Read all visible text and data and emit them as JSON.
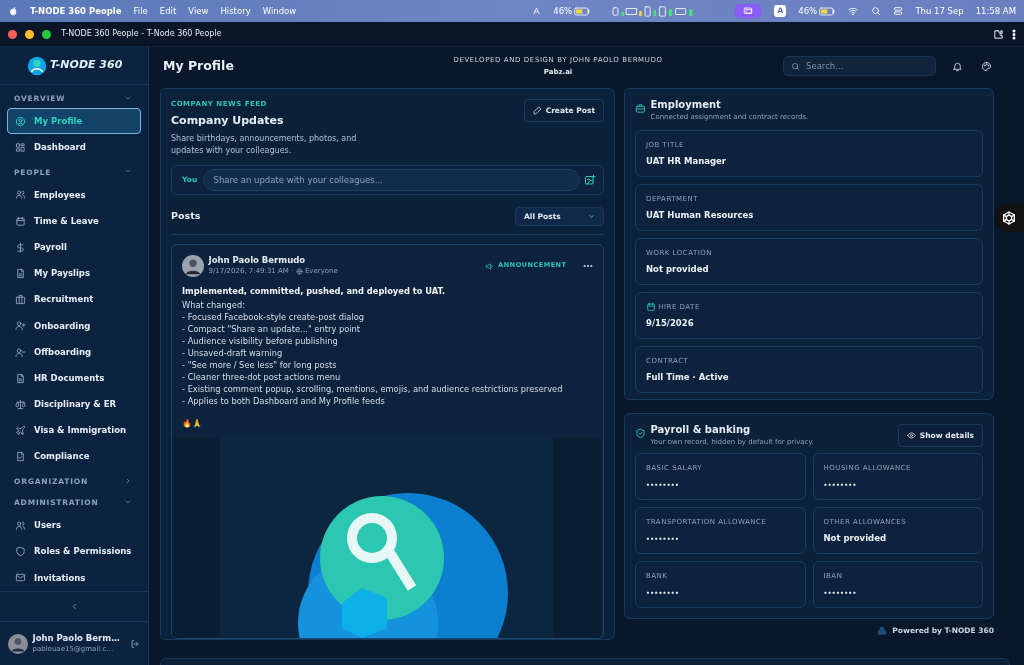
{
  "menubar": {
    "app": "T-NODE 360 People",
    "menus": [
      "File",
      "Edit",
      "View",
      "History",
      "Window"
    ],
    "battery_readings": [
      "46%",
      "46%"
    ],
    "input_source": "A",
    "date": "Thu 17 Sep",
    "time": "11:58 AM"
  },
  "browser": {
    "title": "T-NODE 360 People - T-Node 360 People"
  },
  "brand": {
    "name": "T-NODE 360"
  },
  "header": {
    "title": "My Profile",
    "credit": "DEVELOPED AND DESIGN BY JOHN PAOLO BERMUDO",
    "credit_sub": "Pabz.ai",
    "search": {
      "placeholder": "Search..."
    }
  },
  "sidebar": {
    "sections": [
      {
        "label": "OVERVIEW",
        "expanded": true,
        "items": [
          {
            "label": "My Profile",
            "selected": true
          },
          {
            "label": "Dashboard",
            "selected": false
          }
        ]
      },
      {
        "label": "PEOPLE",
        "expanded": true,
        "items": [
          {
            "label": "Employees",
            "selected": false
          },
          {
            "label": "Time & Leave",
            "selected": false
          },
          {
            "label": "Payroll",
            "selected": false
          },
          {
            "label": "My Payslips",
            "selected": false
          },
          {
            "label": "Recruitment",
            "selected": false
          },
          {
            "label": "Onboarding",
            "selected": false
          },
          {
            "label": "Offboarding",
            "selected": false
          },
          {
            "label": "HR Documents",
            "selected": false
          },
          {
            "label": "Disciplinary & ER",
            "selected": false
          },
          {
            "label": "Visa & Immigration",
            "selected": false
          },
          {
            "label": "Compliance",
            "selected": false
          }
        ]
      },
      {
        "label": "ORGANIZATION",
        "expanded": false
      },
      {
        "label": "ADMINISTRATION",
        "expanded": true,
        "items": [
          {
            "label": "Users",
            "selected": false
          },
          {
            "label": "Roles & Permissions",
            "selected": false
          },
          {
            "label": "Invitations",
            "selected": false
          }
        ]
      }
    ],
    "user": {
      "name": "John Paolo Berm…",
      "email": "pablouae15@gmail.c…"
    }
  },
  "feed": {
    "eyebrow": "COMPANY NEWS FEED",
    "title": "Company Updates",
    "description": "Share birthdays, announcements, photos, and updates with your colleagues.",
    "create_button": "Create Post",
    "composer": {
      "label": "You",
      "placeholder": "Share an update with your colleagues..."
    },
    "posts_title": "Posts",
    "filter": {
      "value": "All Posts"
    },
    "posts": [
      {
        "author": "John Paolo Bermudo",
        "timestamp": "9/17/2026, 7:49:31 AM",
        "separator": "·",
        "audience": "Everyone",
        "tag": "ANNOUNCEMENT",
        "headline": "Implemented, committed, pushed, and deployed to UAT.",
        "lines": [
          "What changed:",
          "- Focused Facebook-style create-post dialog",
          "- Compact \"Share an update...\" entry point",
          "- Audience visibility before publishing",
          "- Unsaved-draft warning",
          "- \"See more / See less\" for long posts",
          "- Cleaner three-dot post actions menu",
          "- Existing comment popup, scrolling, mentions, emojis, and audience restrictions preserved",
          "- Applies to both Dashboard and My Profile feeds"
        ],
        "emoji": "🔥🙏"
      }
    ]
  },
  "employment": {
    "title": "Employment",
    "subtitle": "Connected assignment and contract records.",
    "fields": [
      {
        "label": "JOB TITLE",
        "value": "UAT HR Manager",
        "kind": "text"
      },
      {
        "label": "DEPARTMENT",
        "value": "UAT Human Resources",
        "kind": "text"
      },
      {
        "label": "WORK LOCATION",
        "value": "Not provided",
        "kind": "text"
      },
      {
        "label": "HIRE DATE",
        "value": "9/15/2026",
        "kind": "date"
      },
      {
        "label": "CONTRACT",
        "value": "Full Time · Active",
        "kind": "text"
      }
    ]
  },
  "payroll": {
    "title": "Payroll & banking",
    "subtitle": "Your own record, hidden by default for privacy.",
    "toggle": "Show details",
    "fields": [
      {
        "label": "BASIC SALARY",
        "value": "••••••••",
        "masked": true
      },
      {
        "label": "HOUSING ALLOWANCE",
        "value": "••••••••",
        "masked": true
      },
      {
        "label": "TRANSPORTATION ALLOWANCE",
        "value": "••••••••",
        "masked": true
      },
      {
        "label": "OTHER ALLOWANCES",
        "value": "Not provided",
        "masked": false
      },
      {
        "label": "BANK",
        "value": "••••••••",
        "masked": true
      },
      {
        "label": "IBAN",
        "value": "••••••••",
        "masked": true
      }
    ]
  },
  "footer": {
    "powered": "Powered by T-NODE 360"
  }
}
